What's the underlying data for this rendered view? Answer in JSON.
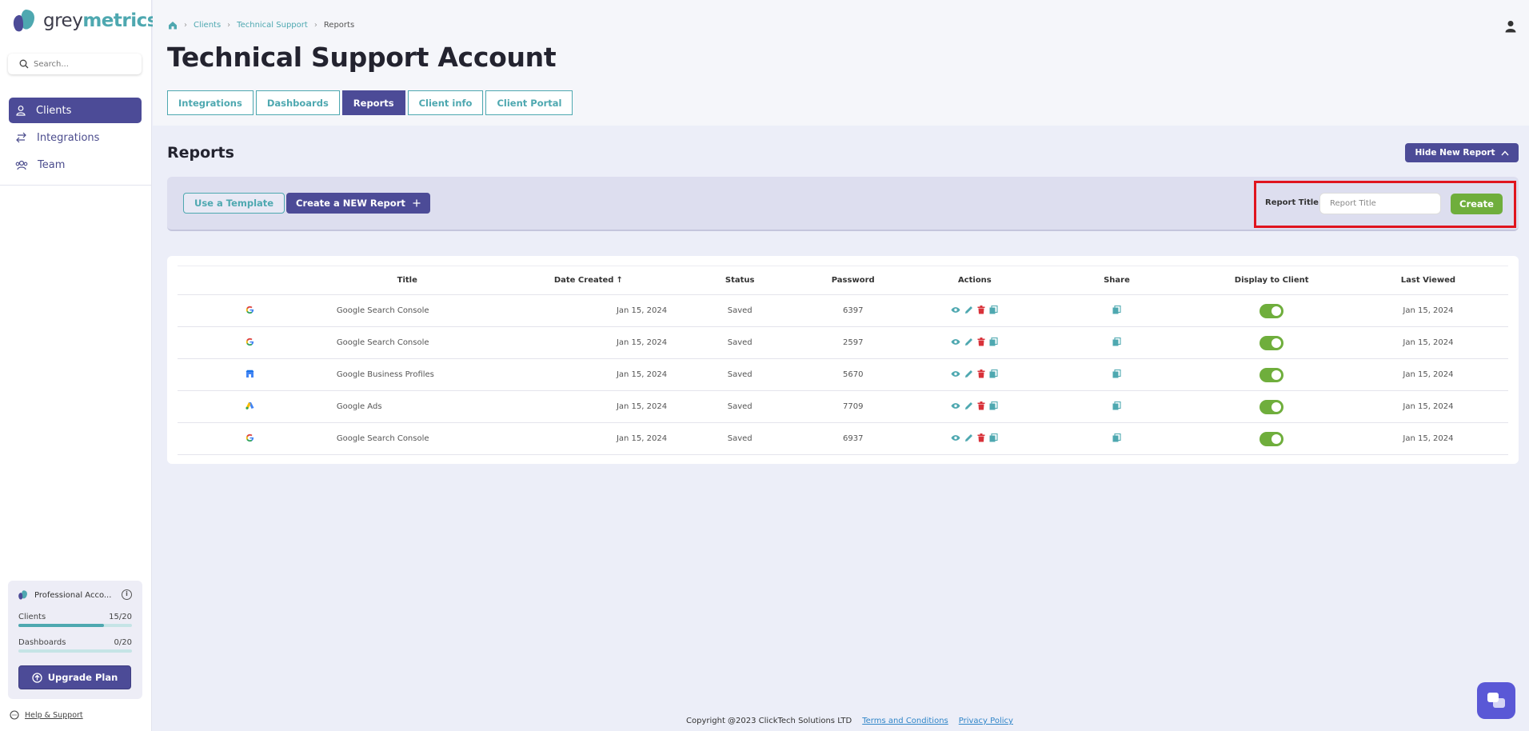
{
  "brand": {
    "name_part1": "grey",
    "name_part2": "metrics"
  },
  "search": {
    "placeholder": "Search..."
  },
  "nav": {
    "items": [
      {
        "label": "Clients",
        "icon": "user-icon",
        "active": true
      },
      {
        "label": "Integrations",
        "icon": "arrows-swap-icon",
        "active": false
      },
      {
        "label": "Team",
        "icon": "team-icon",
        "active": false
      }
    ]
  },
  "plan": {
    "name": "Professional Acco...",
    "usage": [
      {
        "label": "Clients",
        "value": "15/20",
        "fraction": 0.75
      },
      {
        "label": "Dashboards",
        "value": "0/20",
        "fraction": 0
      }
    ],
    "upgrade_label": "Upgrade Plan"
  },
  "help_label": "Help & Support",
  "breadcrumb": {
    "items": [
      "Clients",
      "Technical Support"
    ],
    "current": "Reports"
  },
  "page_title": "Technical Support Account",
  "tabs": [
    {
      "label": "Integrations",
      "active": false
    },
    {
      "label": "Dashboards",
      "active": false
    },
    {
      "label": "Reports",
      "active": true
    },
    {
      "label": "Client info",
      "active": false
    },
    {
      "label": "Client Portal",
      "active": false
    }
  ],
  "reports": {
    "title": "Reports",
    "hide_new_label": "Hide New Report",
    "use_template_label": "Use a Template",
    "create_new_label": "Create a NEW Report",
    "report_title_label": "Report Title",
    "report_title_placeholder": "Report Title",
    "create_label": "Create"
  },
  "table": {
    "headers": [
      "Title",
      "Date Created",
      "Status",
      "Password",
      "Actions",
      "Share",
      "Display to Client",
      "Last Viewed"
    ],
    "rows": [
      {
        "icon": "google-icon",
        "title": "Google Search Console",
        "date": "Jan 15, 2024",
        "status": "Saved",
        "password": "6397",
        "display": true,
        "last_viewed": "Jan 15, 2024"
      },
      {
        "icon": "google-icon",
        "title": "Google Search Console",
        "date": "Jan 15, 2024",
        "status": "Saved",
        "password": "2597",
        "display": true,
        "last_viewed": "Jan 15, 2024"
      },
      {
        "icon": "google-business-icon",
        "title": "Google Business Profiles",
        "date": "Jan 15, 2024",
        "status": "Saved",
        "password": "5670",
        "display": true,
        "last_viewed": "Jan 15, 2024"
      },
      {
        "icon": "google-ads-icon",
        "title": "Google Ads",
        "date": "Jan 15, 2024",
        "status": "Saved",
        "password": "7709",
        "display": true,
        "last_viewed": "Jan 15, 2024"
      },
      {
        "icon": "google-icon",
        "title": "Google Search Console",
        "date": "Jan 15, 2024",
        "status": "Saved",
        "password": "6937",
        "display": true,
        "last_viewed": "Jan 15, 2024"
      }
    ]
  },
  "footer": {
    "copyright": "Copyright @2023 ClickTech Solutions LTD",
    "terms": "Terms and Conditions",
    "privacy": "Privacy Policy"
  },
  "colors": {
    "primary": "#4c4b97",
    "teal": "#4ea8b0",
    "green": "#6fae3c",
    "danger": "#d8323a",
    "highlight": "#e0141e"
  }
}
